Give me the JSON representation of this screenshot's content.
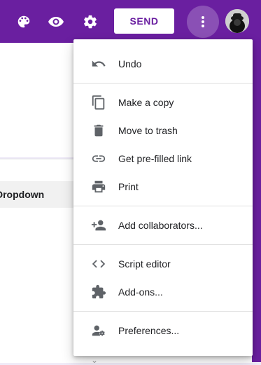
{
  "header": {
    "send_label": "SEND",
    "icons": [
      "palette-icon",
      "eye-icon",
      "settings-icon",
      "more-vert-icon",
      "avatar"
    ],
    "accent_color": "#6a1fa0"
  },
  "background": {
    "dropdown_label": "Dropdown"
  },
  "menu": {
    "items": [
      {
        "label": "Undo",
        "icon": "undo-icon"
      },
      {
        "label": "Make a copy",
        "icon": "copy-icon"
      },
      {
        "label": "Move to trash",
        "icon": "trash-icon"
      },
      {
        "label": "Get pre-filled link",
        "icon": "link-icon"
      },
      {
        "label": "Print",
        "icon": "print-icon"
      },
      {
        "label": "Add collaborators...",
        "icon": "add-people-icon"
      },
      {
        "label": "Script editor",
        "icon": "code-icon"
      },
      {
        "label": "Add-ons...",
        "icon": "puzzle-icon"
      },
      {
        "label": "Preferences...",
        "icon": "preferences-icon"
      }
    ]
  }
}
